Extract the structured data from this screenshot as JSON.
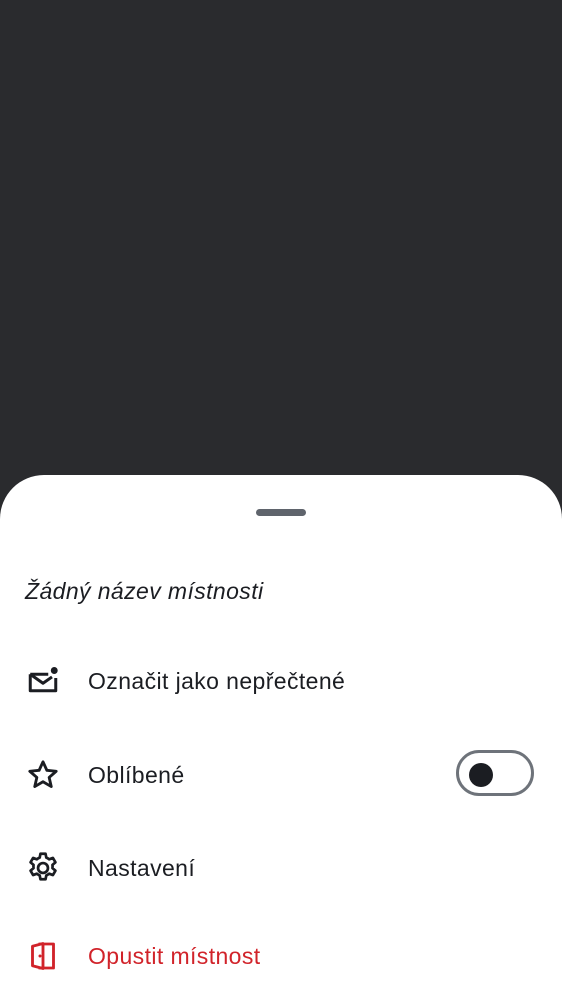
{
  "sheet": {
    "room_name": "Žádný název místnosti",
    "items": [
      {
        "label": "Označit jako nepřečtené",
        "icon": "mark-unread-icon"
      },
      {
        "label": "Oblíbené",
        "icon": "star-icon",
        "toggle_on": false
      },
      {
        "label": "Nastavení",
        "icon": "gear-icon"
      },
      {
        "label": "Opustit místnost",
        "icon": "leave-door-icon",
        "color": "#d1232a"
      }
    ]
  },
  "colors": {
    "scrim": "#2a2b2e",
    "sheet": "#ffffff",
    "text": "#1b1d22",
    "danger": "#d1232a"
  }
}
